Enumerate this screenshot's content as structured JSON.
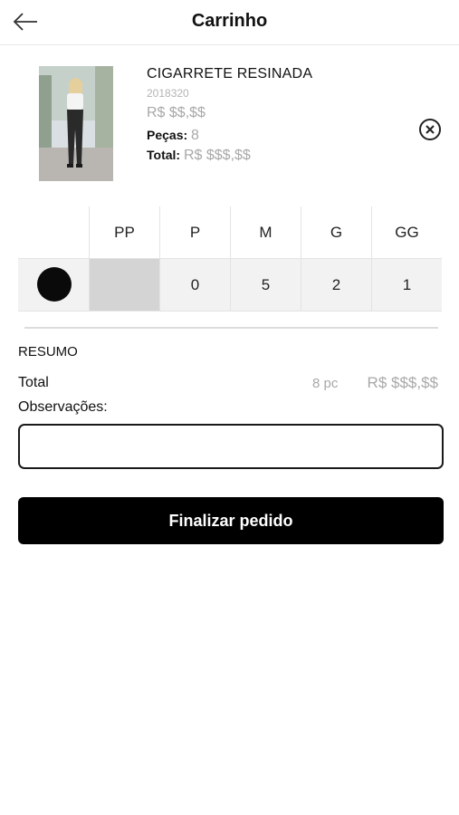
{
  "header": {
    "title": "Carrinho",
    "back_icon": "arrow-left-icon"
  },
  "product": {
    "name": "CIGARRETE RESINADA",
    "sku": "2018320",
    "price": "R$ $$,$$",
    "pieces_label": "Peças:",
    "pieces_value": "8",
    "total_label": "Total:",
    "total_value": "R$ $$$,$$",
    "remove_icon": "close-circle-icon"
  },
  "size_grid": {
    "sizes": [
      "PP",
      "P",
      "M",
      "G",
      "GG"
    ],
    "color_swatch": "#0a0a0a",
    "quantities": [
      "",
      "0",
      "5",
      "2",
      "1"
    ]
  },
  "summary": {
    "title": "RESUMO",
    "total_label": "Total",
    "total_qty": "8 pc",
    "total_value": "R$ $$$,$$",
    "observations_label": "Observações:",
    "observations_value": "",
    "observations_placeholder": ""
  },
  "actions": {
    "finalize_label": "Finalizar pedido"
  },
  "colors": {
    "primary": "#000000",
    "muted_text": "#a8a8a8",
    "cell_bg": "#f2f2f2",
    "disabled_cell_bg": "#d4d4d4"
  }
}
